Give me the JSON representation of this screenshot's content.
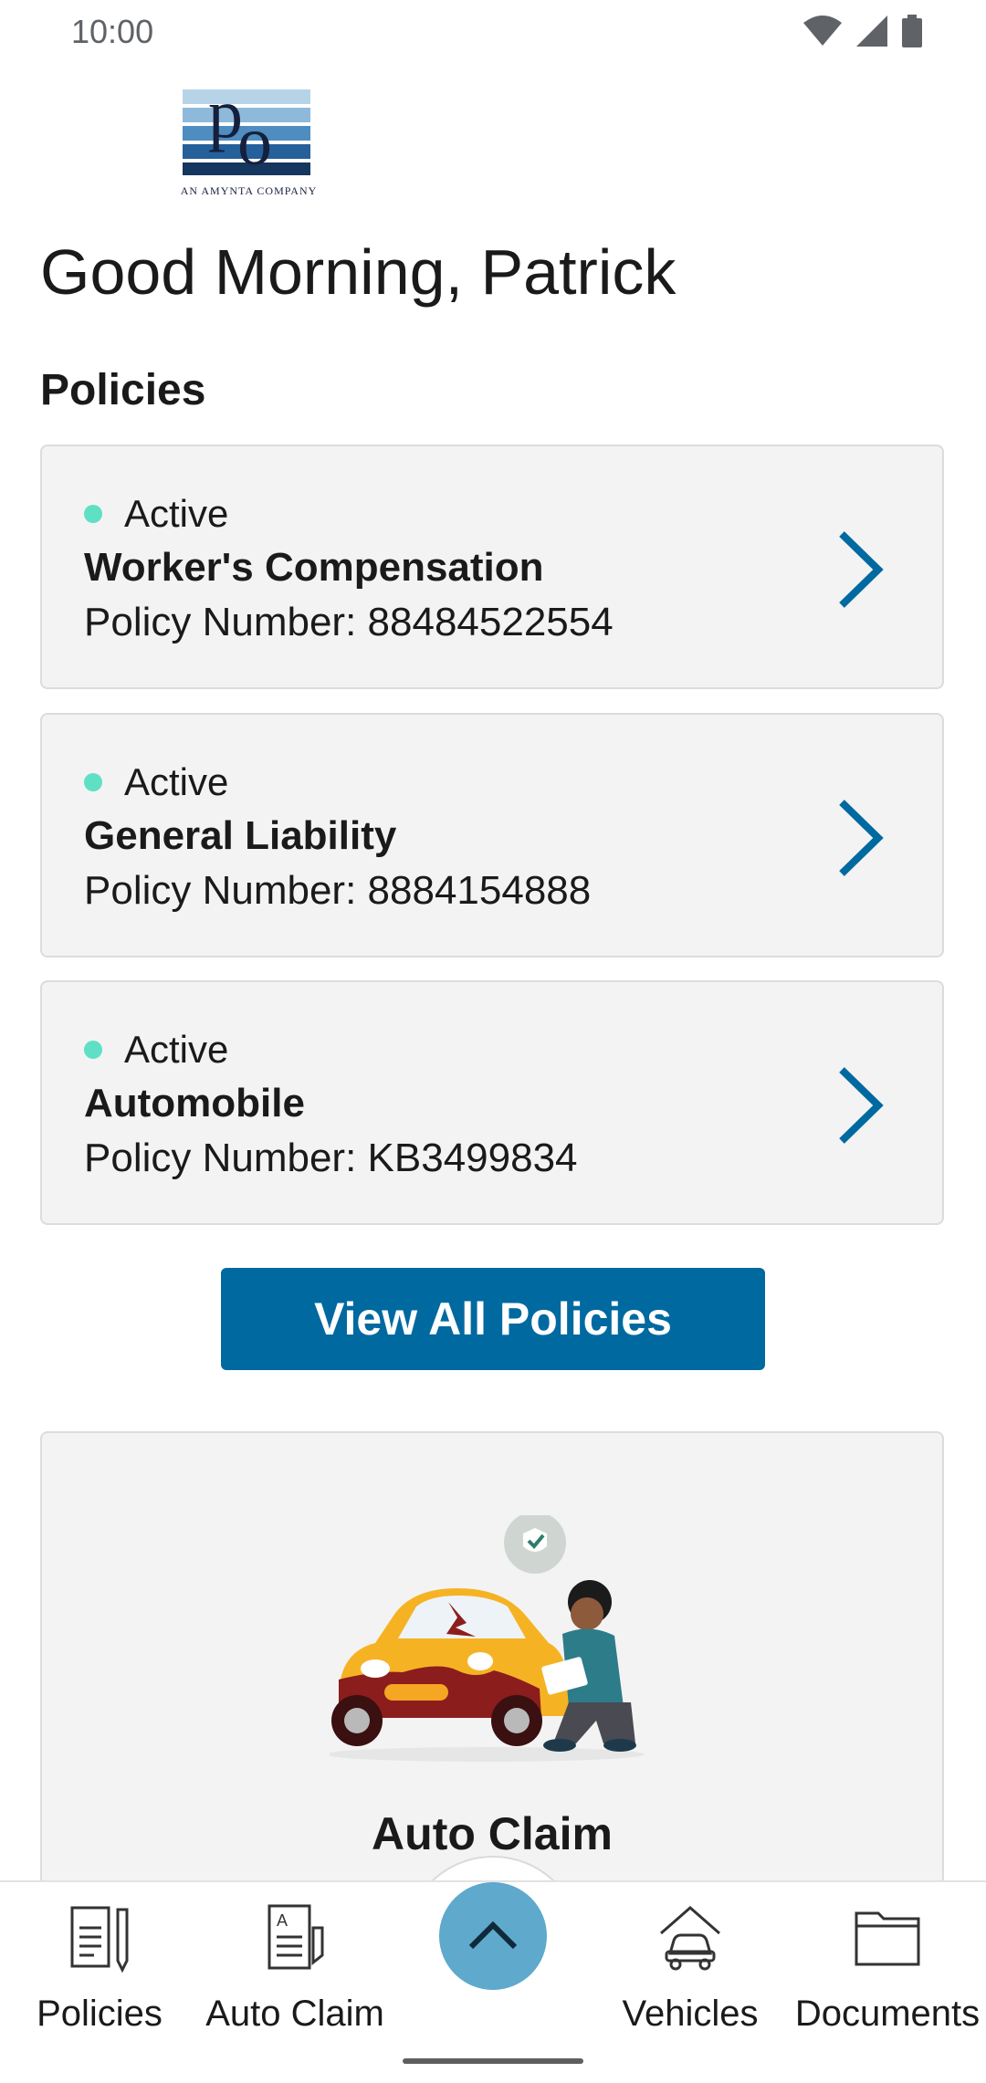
{
  "status_bar": {
    "time": "10:00"
  },
  "logo": {
    "tagline": "AN AMYNTA COMPANY"
  },
  "greeting": "Good Morning, Patrick",
  "policies_section": {
    "title": "Policies",
    "items": [
      {
        "status": "Active",
        "name": "Worker's Compensation",
        "number": "Policy Number: 88484522554"
      },
      {
        "status": "Active",
        "name": "General Liability",
        "number": "Policy Number: 8884154888"
      },
      {
        "status": "Active",
        "name": "Automobile",
        "number": "Policy Number: KB3499834"
      }
    ],
    "view_all_label": "View All Policies"
  },
  "claim_card": {
    "title": "Auto Claim"
  },
  "bottom_nav": {
    "items": [
      {
        "label": "Policies",
        "icon": "policy-document-icon"
      },
      {
        "label": "Auto Claim",
        "icon": "claim-form-icon"
      },
      {
        "label": "Vehicles",
        "icon": "car-garage-icon"
      },
      {
        "label": "Documents",
        "icon": "folder-icon"
      }
    ],
    "fab_icon": "chevron-up-icon"
  },
  "colors": {
    "primary": "#0069a0",
    "status_active": "#5fe0c4",
    "card_bg": "#f3f3f4",
    "fab": "#5ea9cc"
  }
}
